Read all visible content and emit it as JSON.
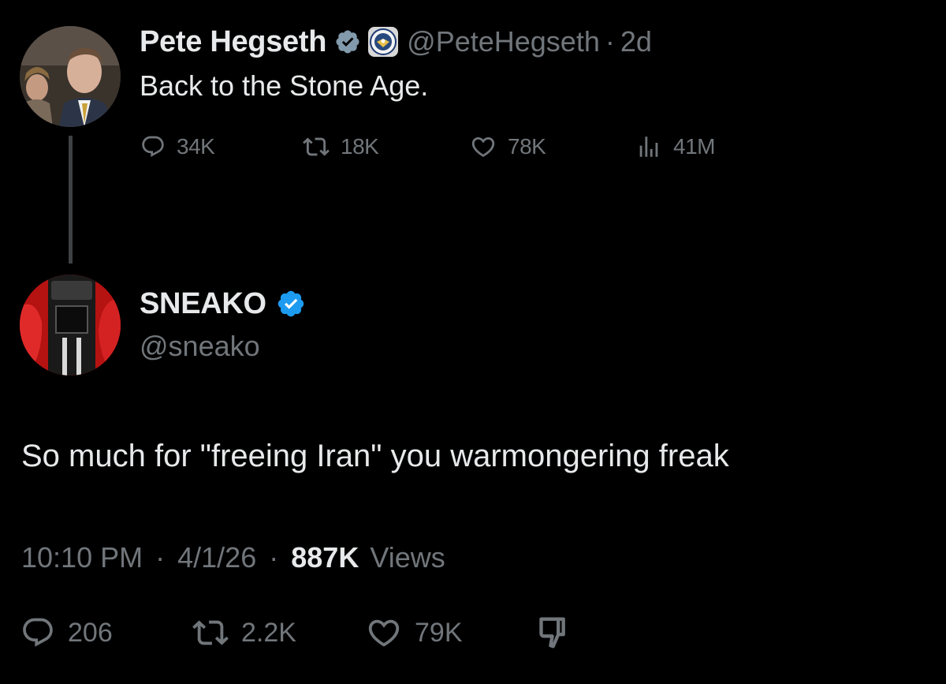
{
  "parent_tweet": {
    "name": "Pete Hegseth",
    "handle": "@PeteHegseth",
    "separator": "·",
    "time": "2d",
    "text": "Back to the Stone Age.",
    "stats": {
      "replies": "34K",
      "reposts": "18K",
      "likes": "78K",
      "views": "41M"
    },
    "icons": [
      "verified-badge-icon",
      "department-seal-icon",
      "reply-icon",
      "repost-icon",
      "like-icon",
      "views-icon"
    ]
  },
  "reply_tweet": {
    "name": "SNEAKO",
    "handle": "@sneako",
    "text": "So much for \"freeing Iran\" you warmongering freak",
    "meta": {
      "time": "10:10 PM",
      "sep1": "·",
      "date": "4/1/26",
      "sep2": "·",
      "views_count": "887K",
      "views_label": "Views"
    },
    "stats": {
      "replies": "206",
      "reposts": "2.2K",
      "likes": "79K"
    },
    "icons": [
      "verified-badge-icon",
      "reply-icon",
      "repost-icon",
      "like-icon",
      "dislike-icon"
    ]
  },
  "colors": {
    "background": "#000000",
    "text_primary": "#e7e9ea",
    "text_secondary": "#71767b",
    "verified_blue": "#1d9bf0",
    "verified_gray": "#829aab"
  }
}
